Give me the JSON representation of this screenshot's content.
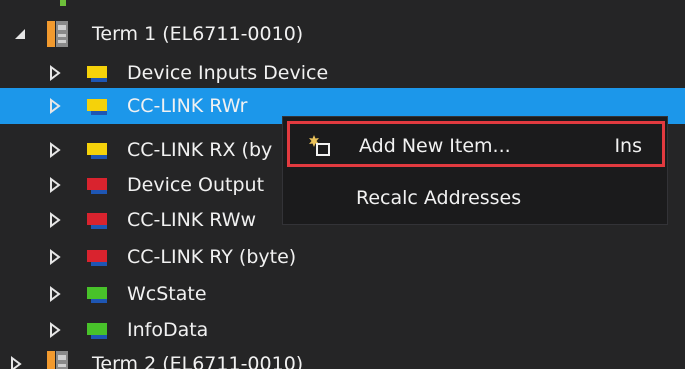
{
  "tree": {
    "items": [
      {
        "label": "Term 1 (EL6711-0010)",
        "icon": "terminal-icon",
        "expanded": true
      },
      {
        "label": "Device Inputs Device",
        "icon": "input-folder-icon",
        "color": "#f5d20a"
      },
      {
        "label": "CC-LINK RWr",
        "icon": "input-folder-icon",
        "color": "#f5d20a",
        "selected": true
      },
      {
        "label": "CC-LINK RX (byte)",
        "icon": "input-folder-icon",
        "color": "#f5d20a",
        "visible": "CC-LINK RX (by"
      },
      {
        "label": "Device Outputs",
        "icon": "output-folder-icon",
        "color": "#d9232e",
        "visible": "Device Output"
      },
      {
        "label": "CC-LINK RWw",
        "icon": "output-folder-icon",
        "color": "#d9232e"
      },
      {
        "label": "CC-LINK RY (byte)",
        "icon": "output-folder-icon",
        "color": "#d9232e"
      },
      {
        "label": "WcState",
        "icon": "status-folder-icon",
        "color": "#48c22a"
      },
      {
        "label": "InfoData",
        "icon": "status-folder-icon",
        "color": "#48c22a"
      },
      {
        "label": "Term 2 (EL6711-0010)",
        "icon": "terminal-icon",
        "expanded": false
      }
    ]
  },
  "context_menu": {
    "items": [
      {
        "label": "Add New Item...",
        "shortcut": "Ins",
        "icon": "add-new-item-icon",
        "highlighted": true
      },
      {
        "label": "Recalc Addresses",
        "shortcut": ""
      }
    ]
  },
  "colors": {
    "background": "#252526",
    "selection": "#1c97ea",
    "menu_background": "#1b1b1c",
    "highlight_border": "#e23a3f",
    "text": "#f1f1f1"
  }
}
